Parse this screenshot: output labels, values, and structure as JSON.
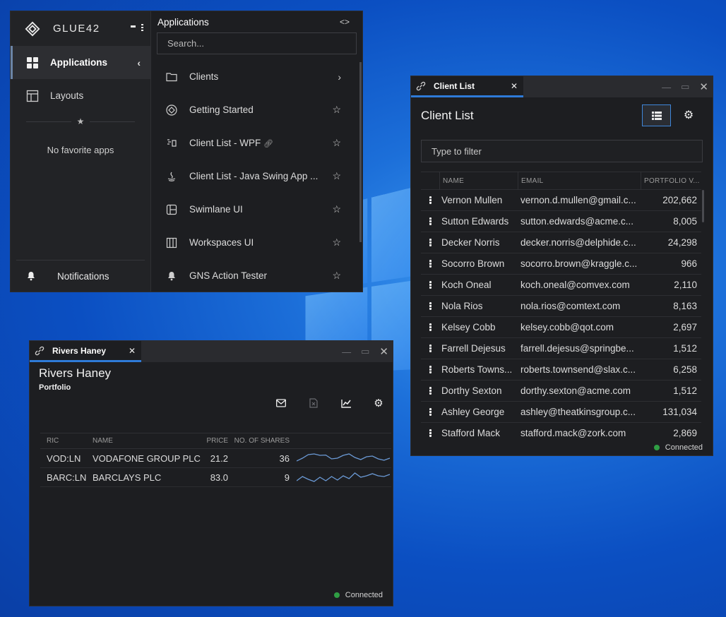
{
  "colors": {
    "accent": "#2e7bd8",
    "connected": "#2f9e44",
    "sparkline": "#6b9ad6",
    "panel": "#1d1e21"
  },
  "launcher": {
    "brand": "GLUE42",
    "nav": [
      {
        "label": "Applications",
        "icon": "apps-grid-icon",
        "active": true
      },
      {
        "label": "Layouts",
        "icon": "layout-icon",
        "active": false
      }
    ],
    "no_favorites": "No favorite apps",
    "notifications_label": "Notifications",
    "panel_title": "Applications",
    "search_placeholder": "Search...",
    "apps": [
      {
        "name": "Clients",
        "icon": "folder-icon",
        "end": "chevron-right-icon"
      },
      {
        "name": "Getting Started",
        "icon": "glue-logo-icon",
        "end": "star-icon"
      },
      {
        "name": "Client List - WPF",
        "icon": "wpf-icon",
        "end": "star-icon",
        "linked": true
      },
      {
        "name": "Client List - Java Swing App ...",
        "icon": "java-icon",
        "end": "star-icon"
      },
      {
        "name": "Swimlane UI",
        "icon": "swimlane-icon",
        "end": "star-icon"
      },
      {
        "name": "Workspaces UI",
        "icon": "workspaces-icon",
        "end": "star-icon"
      },
      {
        "name": "GNS Action Tester",
        "icon": "bell-icon",
        "end": "star-icon"
      }
    ]
  },
  "client_list": {
    "tab_label": "Client List",
    "title": "Client List",
    "filter_placeholder": "Type to filter",
    "columns": [
      "NAME",
      "EMAIL",
      "PORTFOLIO V..."
    ],
    "rows": [
      {
        "name": "Vernon Mullen",
        "email": "vernon.d.mullen@gmail.c...",
        "value": "202,662"
      },
      {
        "name": "Sutton Edwards",
        "email": "sutton.edwards@acme.c...",
        "value": "8,005"
      },
      {
        "name": "Decker Norris",
        "email": "decker.norris@delphide.c...",
        "value": "24,298"
      },
      {
        "name": "Socorro Brown",
        "email": "socorro.brown@kraggle.c...",
        "value": "966"
      },
      {
        "name": "Koch Oneal",
        "email": "koch.oneal@comvex.com",
        "value": "2,110"
      },
      {
        "name": "Nola Rios",
        "email": "nola.rios@comtext.com",
        "value": "8,163"
      },
      {
        "name": "Kelsey Cobb",
        "email": "kelsey.cobb@qot.com",
        "value": "2,697"
      },
      {
        "name": "Farrell Dejesus",
        "email": "farrell.dejesus@springbe...",
        "value": "1,512"
      },
      {
        "name": "Roberts Towns...",
        "email": "roberts.townsend@slax.c...",
        "value": "6,258"
      },
      {
        "name": "Dorthy Sexton",
        "email": "dorthy.sexton@acme.com",
        "value": "1,512"
      },
      {
        "name": "Ashley George",
        "email": "ashley@theatkinsgroup.c...",
        "value": "131,034"
      },
      {
        "name": "Stafford Mack",
        "email": "stafford.mack@zork.com",
        "value": "2,869"
      }
    ],
    "status": "Connected"
  },
  "portfolio": {
    "tab_label": "Rivers Haney",
    "title": "Rivers Haney",
    "subtitle": "Portfolio",
    "tools": [
      "email-icon",
      "export-excel-icon",
      "chart-icon",
      "gear-icon"
    ],
    "columns": {
      "ric": "RIC",
      "name": "NAME",
      "price": "PRICE",
      "shares": "NO. OF SHARES"
    },
    "rows": [
      {
        "ric": "VOD:LN",
        "name": "VODAFONE GROUP PLC",
        "price": "21.2",
        "shares": "36",
        "trend": [
          0.3,
          0.5,
          0.75,
          0.8,
          0.7,
          0.72,
          0.45,
          0.5,
          0.7,
          0.8,
          0.55,
          0.4,
          0.6,
          0.65,
          0.45,
          0.35,
          0.5
        ]
      },
      {
        "ric": "BARC:LN",
        "name": "BARCLAYS PLC",
        "price": "83.0",
        "shares": "9",
        "trend": [
          0.25,
          0.55,
          0.35,
          0.2,
          0.5,
          0.25,
          0.55,
          0.3,
          0.6,
          0.4,
          0.8,
          0.5,
          0.6,
          0.75,
          0.6,
          0.55,
          0.7
        ]
      }
    ],
    "status": "Connected"
  }
}
